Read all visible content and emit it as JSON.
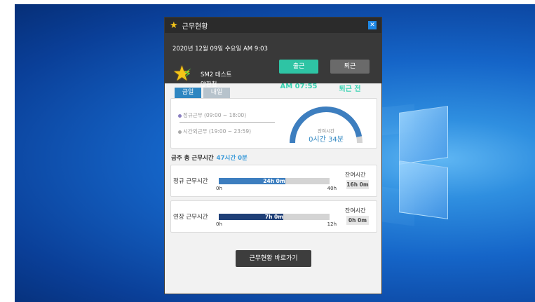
{
  "window": {
    "title": "근무현황"
  },
  "header": {
    "datetime": "2020년 12월 09일 수요일 AM 9:03",
    "company": "SM2 테스트",
    "user": "양환철",
    "checkin_label": "출근",
    "checkout_label": "퇴근",
    "checkin_time": "AM 07:55",
    "checkout_status": "퇴근 전"
  },
  "tabs": [
    {
      "label": "금일"
    },
    {
      "label": "내일"
    }
  ],
  "schedule": {
    "regular": "정규근무 (09:00 ~ 18:00)",
    "overtime": "시간외근무 (19:00 ~ 23:59)",
    "remaining_label": "잔여시간",
    "remaining_value": "0시간 34분",
    "gauge_fraction": 0.94
  },
  "week": {
    "title": "금주 총 근무시간",
    "total": "47시간 0분"
  },
  "bars": [
    {
      "label": "정규 근무시간",
      "value_text": "24h 0m",
      "value": 24,
      "max": 40,
      "min_label": "0h",
      "max_label": "40h",
      "remaining_title": "잔여시간",
      "remaining": "16h 0m",
      "color": "#3d7ebf"
    },
    {
      "label": "연장 근무시간",
      "value_text": "7h 0m",
      "value": 7,
      "max": 12,
      "min_label": "0h",
      "max_label": "12h",
      "remaining_title": "잔여시간",
      "remaining": "0h 0m",
      "color": "#1f3f77"
    }
  ],
  "goto_button": "근무현황 바로가기",
  "colors": {
    "accent": "#2e86c1",
    "checkin": "#2ec4a4",
    "header_bg": "#393939"
  }
}
